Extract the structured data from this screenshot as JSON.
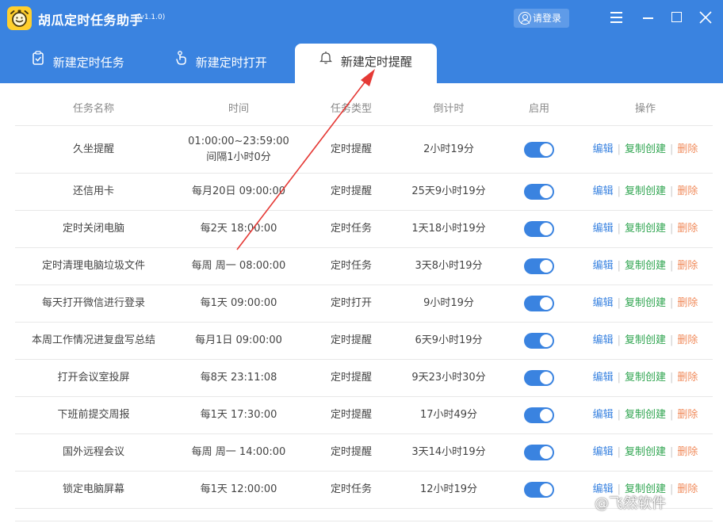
{
  "app": {
    "title": "胡瓜定时任务助手",
    "version": "(v1.1.0)",
    "login_label": "请登录"
  },
  "colors": {
    "header_bg": "#3a83e0",
    "accent": "#3a83e0",
    "edit": "#3a83e0",
    "copy": "#2ea44f",
    "delete": "#f08a5a",
    "arrow": "#e53935"
  },
  "icons": {
    "logo": "stopwatch-logo-icon",
    "login": "user-icon",
    "menu": "menu-icon",
    "minimize": "minimize-icon",
    "maximize": "maximize-icon",
    "close": "close-icon"
  },
  "tabs": [
    {
      "label": "新建定时任务",
      "icon": "clipboard-check-icon",
      "active": false
    },
    {
      "label": "新建定时打开",
      "icon": "hand-pointer-icon",
      "active": false
    },
    {
      "label": "新建定时提醒",
      "icon": "bell-icon",
      "active": true
    }
  ],
  "table": {
    "headers": [
      "任务名称",
      "时间",
      "任务类型",
      "倒计时",
      "启用",
      "操作"
    ],
    "ops": {
      "edit": "编辑",
      "copy": "复制创建",
      "delete": "删除",
      "separator": "|"
    },
    "rows": [
      {
        "name": "久坐提醒",
        "time": "01:00:00~23:59:00 间隔1小时0分",
        "type": "定时提醒",
        "countdown": "2小时19分",
        "enabled": true
      },
      {
        "name": "还信用卡",
        "time": "每月20日 09:00:00",
        "type": "定时提醒",
        "countdown": "25天9小时19分",
        "enabled": true
      },
      {
        "name": "定时关闭电脑",
        "time": "每2天 18:00:00",
        "type": "定时任务",
        "countdown": "1天18小时19分",
        "enabled": true
      },
      {
        "name": "定时清理电脑垃圾文件",
        "time": "每周 周一 08:00:00",
        "type": "定时任务",
        "countdown": "3天8小时19分",
        "enabled": true
      },
      {
        "name": "每天打开微信进行登录",
        "time": "每1天 09:00:00",
        "type": "定时打开",
        "countdown": "9小时19分",
        "enabled": true
      },
      {
        "name": "本周工作情况进复盘写总结",
        "time": "每月1日 09:00:00",
        "type": "定时提醒",
        "countdown": "6天9小时19分",
        "enabled": true
      },
      {
        "name": "打开会议室投屏",
        "time": "每8天 23:11:08",
        "type": "定时提醒",
        "countdown": "9天23小时30分",
        "enabled": true
      },
      {
        "name": "下班前提交周报",
        "time": "每1天 17:30:00",
        "type": "定时提醒",
        "countdown": "17小时49分",
        "enabled": true
      },
      {
        "name": "国外远程会议",
        "time": "每周 周一 14:00:00",
        "type": "定时提醒",
        "countdown": "3天14小时19分",
        "enabled": true
      },
      {
        "name": "锁定电脑屏幕",
        "time": "每1天 12:00:00",
        "type": "定时任务",
        "countdown": "12小时19分",
        "enabled": true
      }
    ]
  },
  "watermark": "@飞然软件"
}
